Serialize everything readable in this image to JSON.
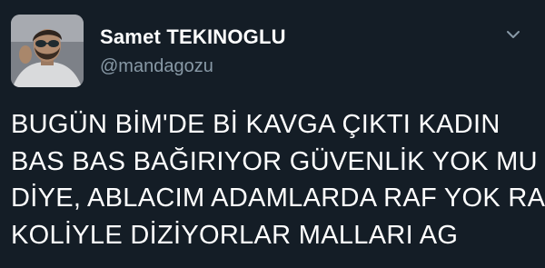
{
  "tweet": {
    "author": {
      "name": "Samet TEKINOGLU",
      "handle": "@mandagozu"
    },
    "menu_icon": "chevron-down-icon",
    "text_lines": [
      "BUGÜN BİM'DE Bİ KAVGA ÇIKTI KADIN",
      "BAS BAS BAĞIRIYOR GÜVENLİK YOK MU",
      "DİYE, ABLACIM ADAMLARDA RAF YOK RAF",
      "KOLİYLE DİZİYORLAR MALLARI AG"
    ]
  },
  "colors": {
    "background": "#141d26",
    "name": "#ffffff",
    "handle": "#8899a6",
    "text": "#ffffff",
    "chevron": "#8899a6"
  }
}
